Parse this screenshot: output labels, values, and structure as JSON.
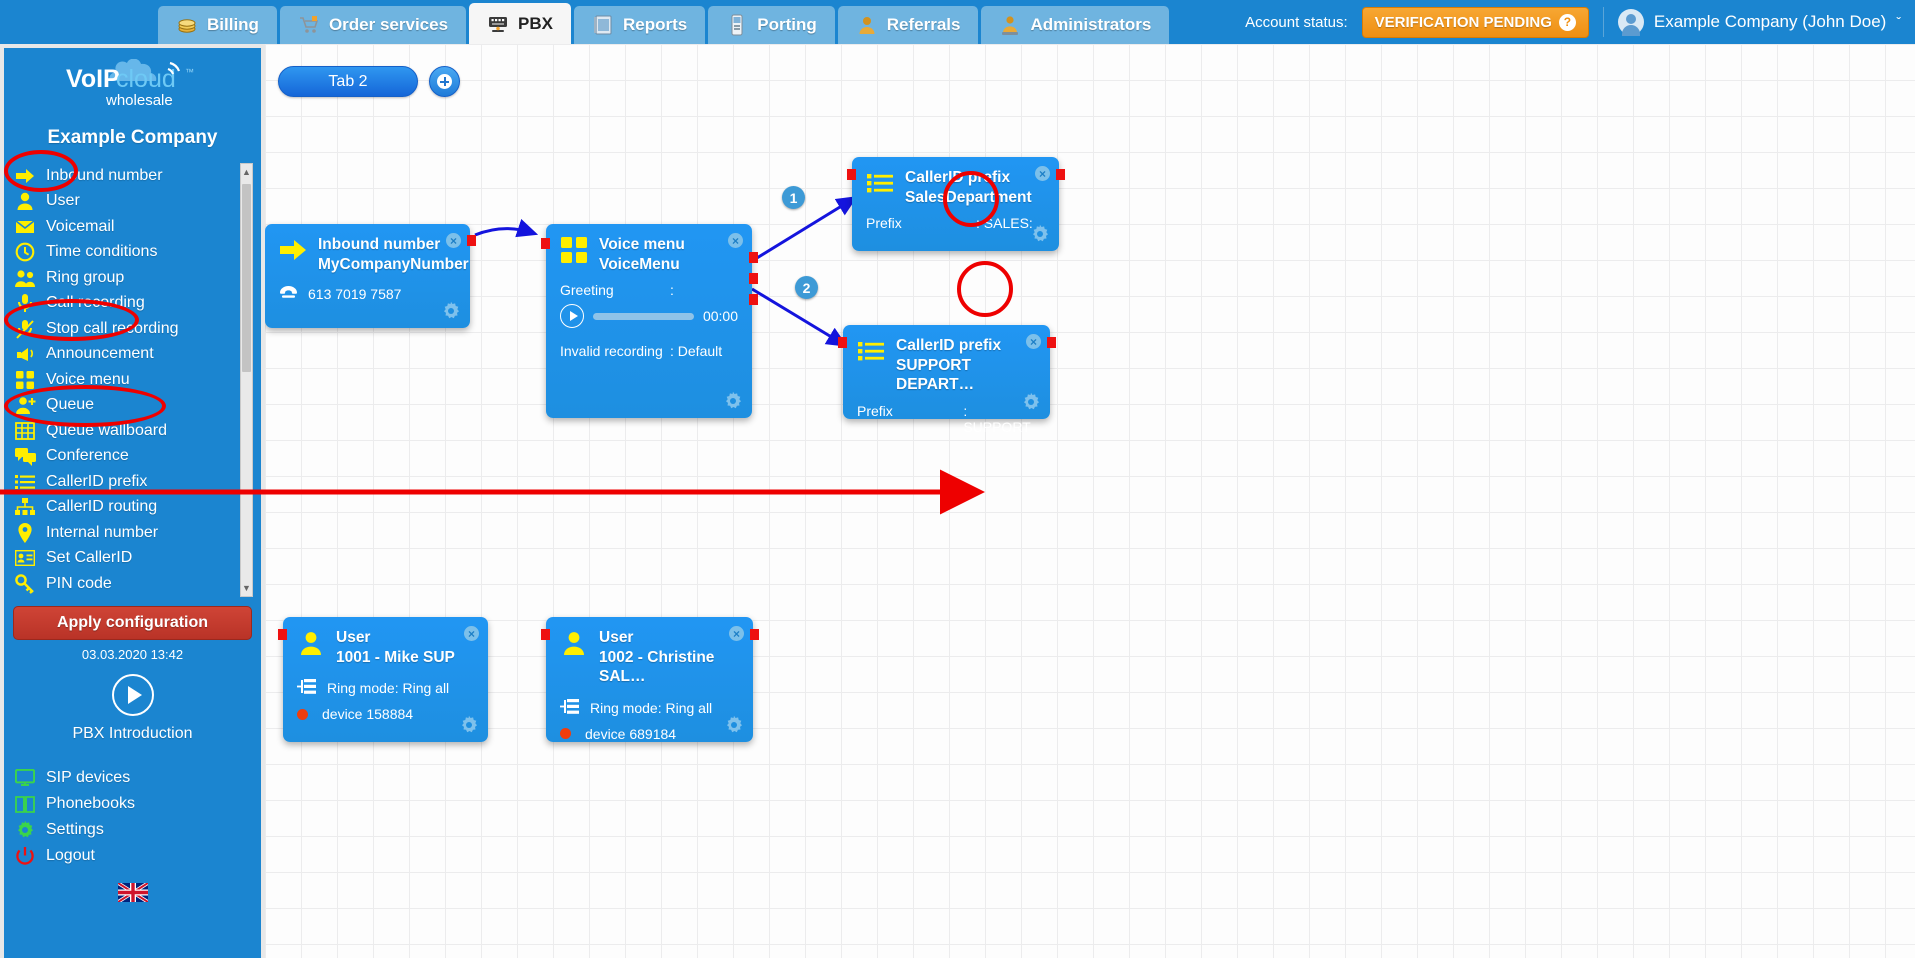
{
  "topnav": {
    "tabs": [
      {
        "label": "Billing",
        "icon": "coins-icon",
        "active": false
      },
      {
        "label": "Order services",
        "icon": "shopping-cart-icon",
        "active": false
      },
      {
        "label": "PBX",
        "icon": "pbx-icon",
        "active": true
      },
      {
        "label": "Reports",
        "icon": "book-icon",
        "active": false
      },
      {
        "label": "Porting",
        "icon": "mobile-phone-icon",
        "active": false
      },
      {
        "label": "Referrals",
        "icon": "person-icon",
        "active": false
      },
      {
        "label": "Administrators",
        "icon": "admin-person-icon",
        "active": false
      }
    ],
    "account_status_label": "Account status:",
    "account_status_value": "VERIFICATION PENDING",
    "account_status_help": "?",
    "account_user": "Example Company (John Doe)",
    "chevron": "ˇ"
  },
  "sidebar": {
    "logo_main": "VoIP",
    "logo_cloud": "cloud",
    "logo_sub": "wholesale",
    "company": "Example Company",
    "menu": [
      {
        "label": "Inbound number",
        "icon": "right-arrow-icon"
      },
      {
        "label": "User",
        "icon": "user-icon"
      },
      {
        "label": "Voicemail",
        "icon": "envelope-icon"
      },
      {
        "label": "Time conditions",
        "icon": "clock-icon"
      },
      {
        "label": "Ring group",
        "icon": "group-icon"
      },
      {
        "label": "Call recording",
        "icon": "microphone-icon"
      },
      {
        "label": "Stop call recording",
        "icon": "microphone-muted-icon"
      },
      {
        "label": "Announcement",
        "icon": "megaphone-icon"
      },
      {
        "label": "Voice menu",
        "icon": "grid-squares-icon"
      },
      {
        "label": "Queue",
        "icon": "user-plus-icon"
      },
      {
        "label": "Queue wallboard",
        "icon": "table-icon"
      },
      {
        "label": "Conference",
        "icon": "chat-bubbles-icon"
      },
      {
        "label": "CallerID prefix",
        "icon": "list-icon"
      },
      {
        "label": "CallerID routing",
        "icon": "sitemap-icon"
      },
      {
        "label": "Internal number",
        "icon": "map-pin-icon"
      },
      {
        "label": "Set CallerID",
        "icon": "id-card-icon"
      },
      {
        "label": "PIN code",
        "icon": "key-icon"
      }
    ],
    "apply_label": "Apply configuration",
    "apply_time": "03.03.2020 13:42",
    "intro_label": "PBX Introduction",
    "bottom_menu": [
      {
        "label": "SIP devices",
        "icon": "monitor-icon"
      },
      {
        "label": "Phonebooks",
        "icon": "address-book-icon"
      },
      {
        "label": "Settings",
        "icon": "gear-icon"
      },
      {
        "label": "Logout",
        "icon": "power-icon"
      }
    ],
    "language": "en-GB"
  },
  "canvas": {
    "tab_label": "Tab 2",
    "add_tab_label": "+",
    "connector_badges": [
      "1",
      "2"
    ],
    "nodes": [
      {
        "id": "inbound-number",
        "type_label": "Inbound number",
        "name_label": "MyCompanyNumber",
        "icon": "right-arrow-icon",
        "detail_icon": "telephone-icon",
        "detail_value": "613 7019 7587",
        "close": "×"
      },
      {
        "id": "voice-menu",
        "type_label": "Voice menu",
        "name_label": "VoiceMenu",
        "icon": "grid-squares-icon",
        "greeting_key": "Greeting",
        "greeting_sep": ":",
        "greeting_time": "00:00",
        "invalid_key": "Invalid recording",
        "invalid_value": ": Default",
        "close": "×"
      },
      {
        "id": "callerid-prefix-sales",
        "type_label": "CallerID prefix",
        "name_label": "SalesDepartment",
        "icon": "list-icon",
        "prefix_key": "Prefix",
        "prefix_value": ": SALES:",
        "close": "×"
      },
      {
        "id": "callerid-prefix-support",
        "type_label": "CallerID prefix",
        "name_label": "SUPPORT DEPART…",
        "icon": "list-icon",
        "prefix_key": "Prefix",
        "prefix_value": ": SUPPORT",
        "close": "×"
      },
      {
        "id": "user-1001",
        "type_label": "User",
        "name_label": "1001 - Mike SUP",
        "icon": "user-icon",
        "ring_mode": "Ring mode: Ring all",
        "device": "device 158884",
        "close": "×"
      },
      {
        "id": "user-1002",
        "type_label": "User",
        "name_label": "1002 - Christine SAL…",
        "icon": "user-icon",
        "ring_mode": "Ring mode: Ring all",
        "device": "device 689184",
        "close": "×"
      }
    ]
  },
  "colors": {
    "brand_blue": "#1b85d0",
    "node_blue": "#2196f3",
    "accent_yellow": "#ffee00",
    "annotation_red": "#ee0000",
    "status_orange": "#ef8f12",
    "apply_red": "#c23a2c",
    "connector_blue": "#1414dd",
    "port_red": "#ee1111"
  }
}
